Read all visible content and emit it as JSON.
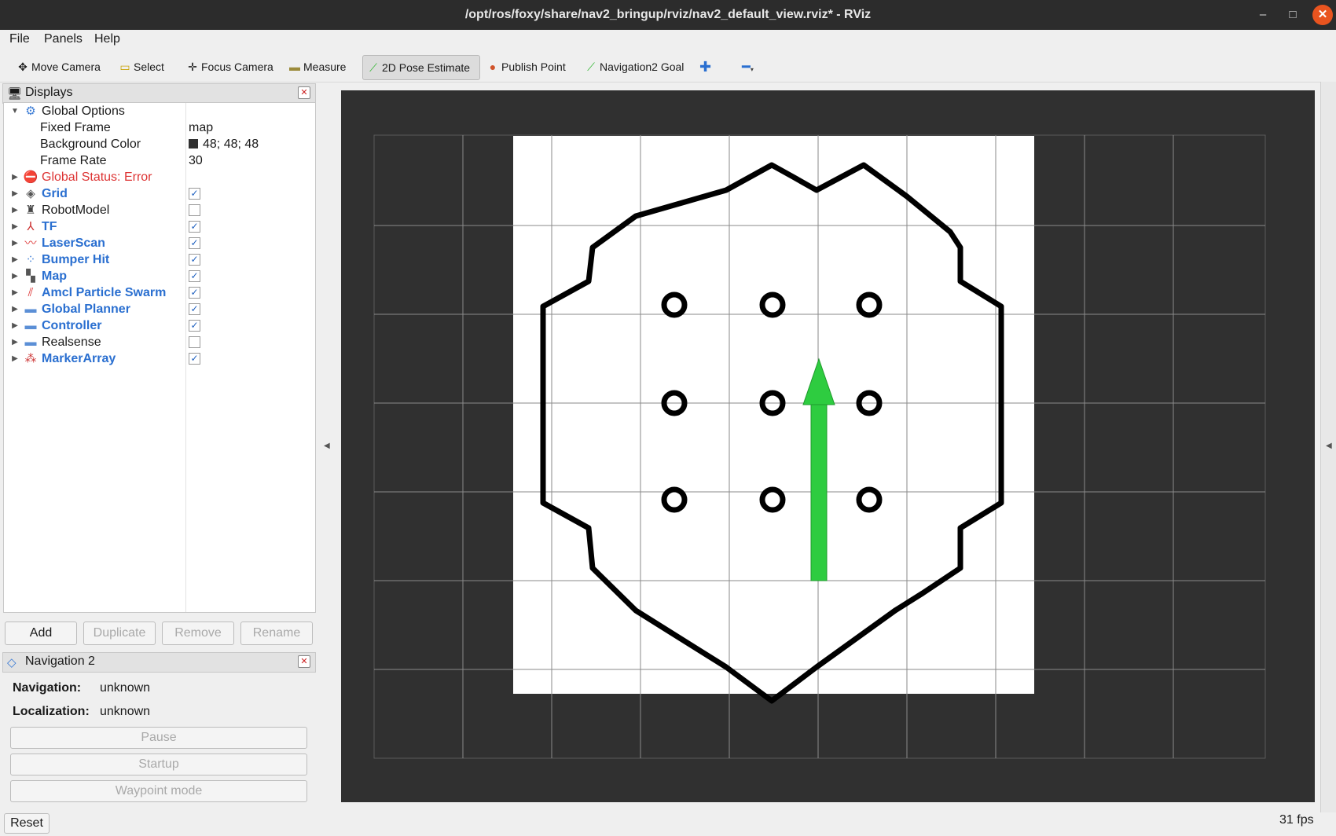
{
  "window": {
    "title": "/opt/ros/foxy/share/nav2_bringup/rviz/nav2_default_view.rviz* - RViz",
    "controls": {
      "minimize": "–",
      "maximize": "□",
      "close": "✕"
    }
  },
  "menu": [
    {
      "label": "File"
    },
    {
      "label": "Panels"
    },
    {
      "label": "Help"
    }
  ],
  "toolbar": {
    "move_camera": "Move Camera",
    "select": "Select",
    "focus_camera": "Focus Camera",
    "measure": "Measure",
    "pose_estimate": "2D Pose Estimate",
    "publish_point": "Publish Point",
    "nav_goal": "Navigation2 Goal",
    "add_tool_icon": "plus-icon",
    "remove_tool_icon": "minus-icon"
  },
  "displays": {
    "title": "Displays",
    "global_options": {
      "label": "Global Options",
      "fixed_frame_label": "Fixed Frame",
      "fixed_frame_value": "map",
      "background_color_label": "Background Color",
      "background_color_value": "48; 48; 48",
      "background_color_hex": "#303030",
      "frame_rate_label": "Frame Rate",
      "frame_rate_value": "30"
    },
    "global_status": "Global Status: Error",
    "items": [
      {
        "label": "Grid",
        "checked": true,
        "icon": "grid-icon"
      },
      {
        "label": "RobotModel",
        "checked": false,
        "icon": "robot-model-icon"
      },
      {
        "label": "TF",
        "checked": true,
        "icon": "tf-axes-icon"
      },
      {
        "label": "LaserScan",
        "checked": true,
        "icon": "laserscan-icon"
      },
      {
        "label": "Bumper Hit",
        "checked": true,
        "icon": "bumper-icon"
      },
      {
        "label": "Map",
        "checked": true,
        "icon": "map-icon"
      },
      {
        "label": "Amcl Particle Swarm",
        "checked": true,
        "icon": "particle-swarm-icon"
      },
      {
        "label": "Global Planner",
        "checked": true,
        "icon": "folder-icon"
      },
      {
        "label": "Controller",
        "checked": true,
        "icon": "folder-icon"
      },
      {
        "label": "Realsense",
        "checked": false,
        "icon": "folder-icon"
      },
      {
        "label": "MarkerArray",
        "checked": true,
        "icon": "marker-icon"
      }
    ],
    "buttons": {
      "add": "Add",
      "duplicate": "Duplicate",
      "remove": "Remove",
      "rename": "Rename"
    }
  },
  "nav2_panel": {
    "title": "Navigation 2",
    "navigation_label": "Navigation:",
    "navigation_value": "unknown",
    "localization_label": "Localization:",
    "localization_value": "unknown",
    "pause": "Pause",
    "startup": "Startup",
    "waypoint_mode": "Waypoint mode"
  },
  "bottom": {
    "reset": "Reset",
    "fps": "31 fps"
  },
  "colors": {
    "viewport_bg": "#303030",
    "map_free": "#ffffff",
    "obstacle": "#000000",
    "arrow": "#2ecc40",
    "grid": "#a8a8a8"
  }
}
